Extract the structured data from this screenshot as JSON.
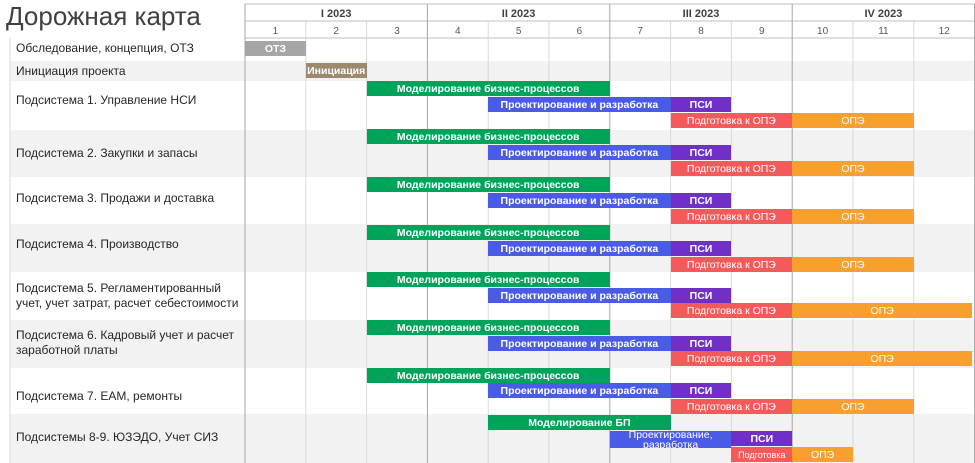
{
  "title": "Дорожная карта",
  "colors": {
    "OTZ": "#a6a6a6",
    "INIT": "#9c8a6e",
    "MODEL": "#00a35a",
    "DESIGN": "#4a5ce6",
    "PSI": "#7030c8",
    "PREP": "#f45a5a",
    "OPE": "#f7a030"
  },
  "chart_data": {
    "type": "gantt",
    "title": "Дорожная карта",
    "quarters": [
      "I 2023",
      "II 2023",
      "III 2023",
      "IV 2023"
    ],
    "months": [
      "1",
      "2",
      "3",
      "4",
      "5",
      "6",
      "7",
      "8",
      "9",
      "10",
      "11",
      "12"
    ],
    "rows": [
      {
        "label": "Обследование, концепция, ОТЗ",
        "tasks": [
          {
            "name": "ОТЗ",
            "start": 1,
            "end": 1,
            "kind": "OTZ"
          }
        ]
      },
      {
        "label": "Инициация проекта",
        "tasks": [
          {
            "name": "Инициация",
            "start": 2,
            "end": 2,
            "kind": "INIT"
          }
        ]
      },
      {
        "label": "Подсистема 1. Управление НСИ",
        "tasks": [
          {
            "name": "Моделирование бизнес-процессов",
            "start": 3,
            "end": 6,
            "kind": "MODEL"
          },
          {
            "name": "Проектирование и разработка",
            "start": 5,
            "end": 7,
            "kind": "DESIGN"
          },
          {
            "name": "ПСИ",
            "start": 8,
            "end": 8,
            "kind": "PSI"
          },
          {
            "name": "Подготовка к ОПЭ",
            "start": 8,
            "end": 9,
            "kind": "PREP"
          },
          {
            "name": "ОПЭ",
            "start": 10,
            "end": 11,
            "kind": "OPE"
          }
        ]
      },
      {
        "label": "Подсистема 2. Закупки и запасы",
        "tasks": [
          {
            "name": "Моделирование бизнес-процессов",
            "start": 3,
            "end": 6,
            "kind": "MODEL"
          },
          {
            "name": "Проектирование и разработка",
            "start": 5,
            "end": 7,
            "kind": "DESIGN"
          },
          {
            "name": "ПСИ",
            "start": 8,
            "end": 8,
            "kind": "PSI"
          },
          {
            "name": "Подготовка к ОПЭ",
            "start": 8,
            "end": 9,
            "kind": "PREP"
          },
          {
            "name": "ОПЭ",
            "start": 10,
            "end": 11,
            "kind": "OPE"
          }
        ]
      },
      {
        "label": "Подсистема 3. Продажи и доставка",
        "tasks": [
          {
            "name": "Моделирование бизнес-процессов",
            "start": 3,
            "end": 6,
            "kind": "MODEL"
          },
          {
            "name": "Проектирование и разработка",
            "start": 5,
            "end": 7,
            "kind": "DESIGN"
          },
          {
            "name": "ПСИ",
            "start": 8,
            "end": 8,
            "kind": "PSI"
          },
          {
            "name": "Подготовка к ОПЭ",
            "start": 8,
            "end": 9,
            "kind": "PREP"
          },
          {
            "name": "ОПЭ",
            "start": 10,
            "end": 11,
            "kind": "OPE"
          }
        ]
      },
      {
        "label": "Подсистема 4. Производство",
        "tasks": [
          {
            "name": "Моделирование бизнес-процессов",
            "start": 3,
            "end": 6,
            "kind": "MODEL"
          },
          {
            "name": "Проектирование и разработка",
            "start": 5,
            "end": 7,
            "kind": "DESIGN"
          },
          {
            "name": "ПСИ",
            "start": 8,
            "end": 8,
            "kind": "PSI"
          },
          {
            "name": "Подготовка к ОПЭ",
            "start": 8,
            "end": 9,
            "kind": "PREP"
          },
          {
            "name": "ОПЭ",
            "start": 10,
            "end": 11,
            "kind": "OPE"
          }
        ]
      },
      {
        "label": "Подсистема 5. Регламентированный учет, учет затрат, расчет себестоимости",
        "tasks": [
          {
            "name": "Моделирование бизнес-процессов",
            "start": 3,
            "end": 6,
            "kind": "MODEL"
          },
          {
            "name": "Проектирование и разработка",
            "start": 5,
            "end": 7,
            "kind": "DESIGN"
          },
          {
            "name": "ПСИ",
            "start": 8,
            "end": 8,
            "kind": "PSI"
          },
          {
            "name": "Подготовка к ОПЭ",
            "start": 8,
            "end": 9,
            "kind": "PREP"
          },
          {
            "name": "ОПЭ",
            "start": 10,
            "end": 12,
            "kind": "OPE"
          }
        ]
      },
      {
        "label": "Подсистема 6. Кадровый учет и расчет заработной платы",
        "tasks": [
          {
            "name": "Моделирование бизнес-процессов",
            "start": 3,
            "end": 6,
            "kind": "MODEL"
          },
          {
            "name": "Проектирование и разработка",
            "start": 5,
            "end": 7,
            "kind": "DESIGN"
          },
          {
            "name": "ПСИ",
            "start": 8,
            "end": 8,
            "kind": "PSI"
          },
          {
            "name": "Подготовка к ОПЭ",
            "start": 8,
            "end": 9,
            "kind": "PREP"
          },
          {
            "name": "ОПЭ",
            "start": 10,
            "end": 12,
            "kind": "OPE"
          }
        ]
      },
      {
        "label": "Подсистема 7. ЕАМ, ремонты",
        "tasks": [
          {
            "name": "Моделирование бизнес-процессов",
            "start": 3,
            "end": 6,
            "kind": "MODEL"
          },
          {
            "name": "Проектирование и разработка",
            "start": 5,
            "end": 7,
            "kind": "DESIGN"
          },
          {
            "name": "ПСИ",
            "start": 8,
            "end": 8,
            "kind": "PSI"
          },
          {
            "name": "Подготовка к ОПЭ",
            "start": 8,
            "end": 9,
            "kind": "PREP"
          },
          {
            "name": "ОПЭ",
            "start": 10,
            "end": 11,
            "kind": "OPE"
          }
        ]
      },
      {
        "label": "Подсистемы 8-9. ЮЗЭДО, Учет СИЗ",
        "tasks": [
          {
            "name": "Моделирование БП",
            "start": 5,
            "end": 7,
            "kind": "MODEL"
          },
          {
            "name": "Проектирование, разработка",
            "start": 7,
            "end": 8,
            "kind": "DESIGN"
          },
          {
            "name": "ПСИ",
            "start": 9,
            "end": 9,
            "kind": "PSI"
          },
          {
            "name": "Подготовка",
            "start": 9,
            "end": 9,
            "kind": "PREP"
          },
          {
            "name": "ОПЭ",
            "start": 10,
            "end": 10,
            "kind": "OPE"
          }
        ]
      }
    ]
  }
}
